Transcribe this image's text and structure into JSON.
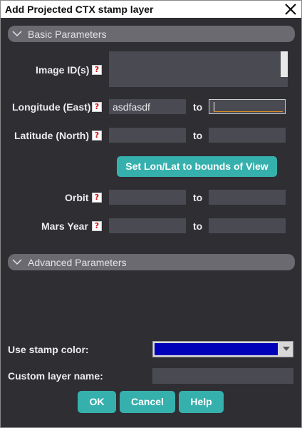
{
  "dialog": {
    "title": "Add Projected CTX stamp layer",
    "close_icon": "close-x-icon"
  },
  "basic": {
    "header": "Basic Parameters",
    "image_ids": {
      "label": "Image ID(s)",
      "value": ""
    },
    "longitude": {
      "label": "Longitude (East)",
      "from": "asdfasdf",
      "to": "",
      "to_label": "to"
    },
    "latitude": {
      "label": "Latitude (North)",
      "from": "",
      "to": "",
      "to_label": "to"
    },
    "set_bounds_label": "Set Lon/Lat to bounds of View",
    "orbit": {
      "label": "Orbit",
      "from": "",
      "to": "",
      "to_label": "to"
    },
    "mars_year": {
      "label": "Mars Year",
      "from": "",
      "to": "",
      "to_label": "to"
    },
    "help_glyph": "?"
  },
  "advanced": {
    "header": "Advanced Parameters"
  },
  "stamp_color": {
    "label": "Use stamp color:",
    "color": "#0000b8"
  },
  "custom_name": {
    "label": "Custom layer name:",
    "value": ""
  },
  "buttons": {
    "ok": "OK",
    "cancel": "Cancel",
    "help": "Help"
  },
  "colors": {
    "background": "#2e2e33",
    "field": "#4a4a52",
    "section": "#6a6a70",
    "accent": "#36b0ac",
    "help_icon": "#d01010"
  }
}
